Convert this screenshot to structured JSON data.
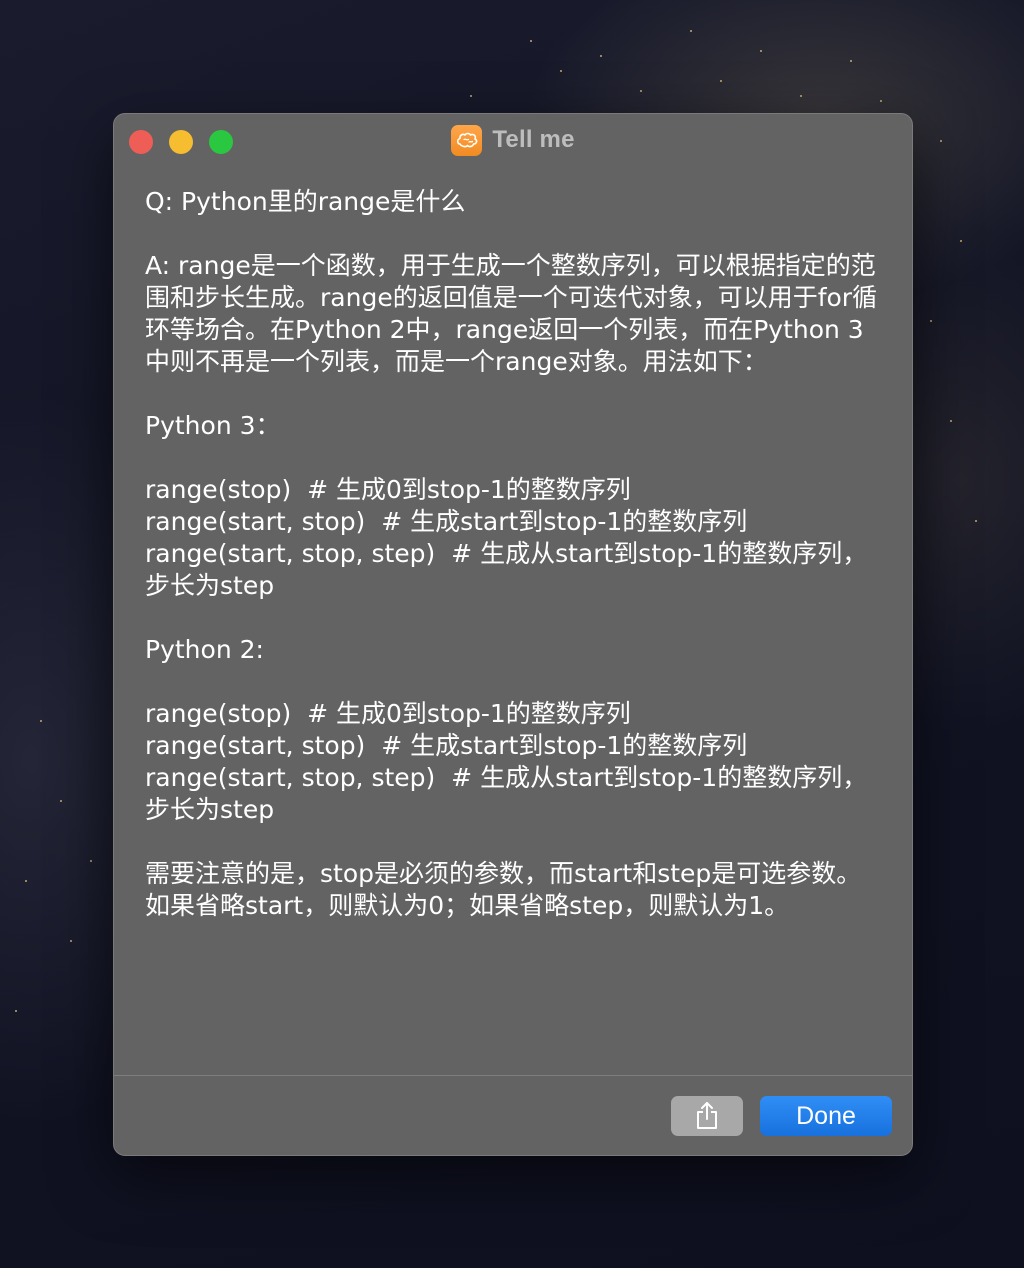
{
  "window": {
    "title": "Tell me",
    "app_icon": "brain-icon",
    "accent_color": "#f39a34"
  },
  "controls": {
    "close": "close-icon",
    "minimize": "minimize-icon",
    "zoom": "zoom-icon"
  },
  "content": {
    "paragraphs": [
      "Q: Python里的range是什么",
      "A: range是一个函数，用于生成一个整数序列，可以根据指定的范围和步长生成。range的返回值是一个可迭代对象，可以用于for循环等场合。在Python 2中，range返回一个列表，而在Python 3中则不再是一个列表，而是一个range对象。用法如下：",
      "Python 3：",
      "range(stop)  # 生成0到stop-1的整数序列\nrange(start, stop)  # 生成start到stop-1的整数序列\nrange(start, stop, step)  # 生成从start到stop-1的整数序列，步长为step",
      "Python 2:",
      "range(stop)  # 生成0到stop-1的整数序列\nrange(start, stop)  # 生成start到stop-1的整数序列\nrange(start, stop, step)  # 生成从start到stop-1的整数序列，步长为step",
      "需要注意的是，stop是必须的参数，而start和step是可选参数。如果省略start，则默认为0；如果省略step，则默认为1。"
    ]
  },
  "footer": {
    "share_icon": "share-icon",
    "done_label": "Done",
    "done_color": "#1e78e6"
  }
}
